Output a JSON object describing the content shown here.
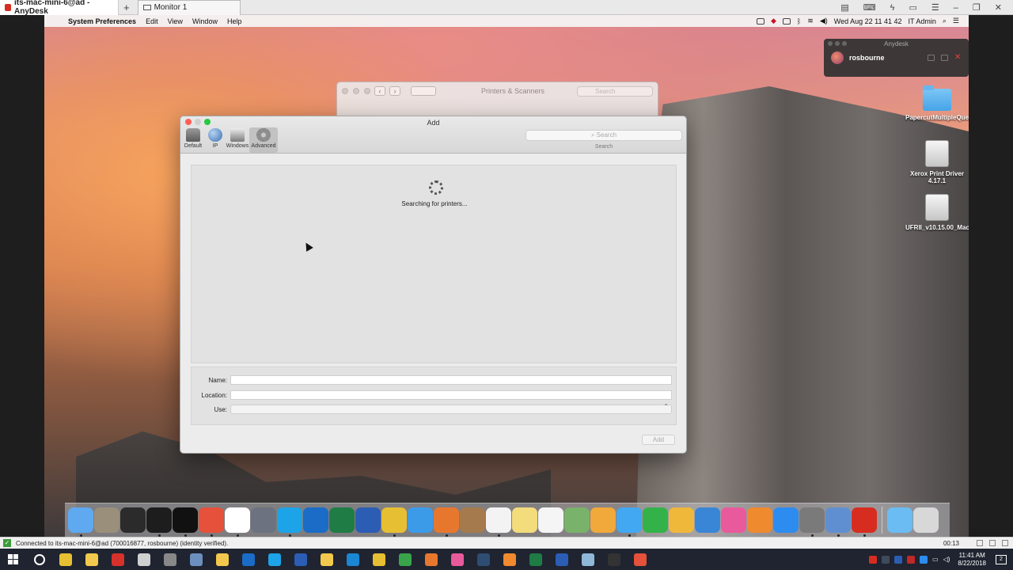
{
  "anydesk": {
    "tab_title": "its-mac-mini-6@ad - AnyDesk",
    "new_tab_label": "+",
    "monitor_tab": "Monitor 1",
    "status_text": "Connected to its-mac-mini-6@ad (700016877, rosbourne) (identity verified).",
    "session_timer": "00:13",
    "window_controls": {
      "minimize": "–",
      "restore": "❐",
      "close": "✕"
    }
  },
  "mac_menubar": {
    "app_name": "System Preferences",
    "menus": [
      "Edit",
      "View",
      "Window",
      "Help"
    ],
    "datetime": "Wed Aug 22  11 41 42",
    "user": "IT Admin"
  },
  "anydesk_panel": {
    "title": "Anydesk",
    "user": "rosbourne"
  },
  "desktop_icons": [
    {
      "label": "PapercutMultipleQueuesTest",
      "icon": "folder-icon"
    },
    {
      "label": "Xerox Print Driver 4.17.1",
      "icon": "disk-image-icon"
    },
    {
      "label": "UFRII_v10.15.00_Mac",
      "icon": "disk-image-icon"
    }
  ],
  "printers_window": {
    "title": "Printers & Scanners",
    "search_placeholder": "Search"
  },
  "add_window": {
    "title": "Add",
    "toolbar": [
      {
        "label": "Default",
        "icon": "printer-icon"
      },
      {
        "label": "IP",
        "icon": "globe-icon"
      },
      {
        "label": "Windows",
        "icon": "windows-printer-icon"
      },
      {
        "label": "Advanced",
        "icon": "gear-icon"
      }
    ],
    "selected_tab": "Advanced",
    "search_placeholder": "Search",
    "search_label": "Search",
    "status": "Searching for printers...",
    "fields": {
      "name_label": "Name:",
      "location_label": "Location:",
      "use_label": "Use:"
    },
    "add_button": "Add"
  },
  "dock": {
    "apps": [
      {
        "name": "Finder",
        "color": "#5ea9f0"
      },
      {
        "name": "Notes Pad",
        "color": "#9a8f7a"
      },
      {
        "name": "Disk Utility",
        "color": "#2b2b2b"
      },
      {
        "name": "Activity Monitor",
        "color": "#1d1d1d"
      },
      {
        "name": "Terminal",
        "color": "#111111"
      },
      {
        "name": "AnyDesk",
        "color": "#e5513b"
      },
      {
        "name": "FLIR Cloud",
        "color": "#ffffff"
      },
      {
        "name": "Launchpad",
        "color": "#6d7280"
      },
      {
        "name": "Skype",
        "color": "#1ca3e8"
      },
      {
        "name": "Outlook",
        "color": "#1a6cc7"
      },
      {
        "name": "Excel",
        "color": "#1f7c45"
      },
      {
        "name": "Word",
        "color": "#2c5db5"
      },
      {
        "name": "Chrome",
        "color": "#e6bf33"
      },
      {
        "name": "Safari",
        "color": "#3c9be8"
      },
      {
        "name": "Firefox",
        "color": "#e8772e"
      },
      {
        "name": "Contacts",
        "color": "#a57a4c"
      },
      {
        "name": "Calendar",
        "color": "#f3f3f3"
      },
      {
        "name": "Notes",
        "color": "#f2dc7c"
      },
      {
        "name": "Reminders",
        "color": "#f5f5f5"
      },
      {
        "name": "Maps",
        "color": "#79b26a"
      },
      {
        "name": "Photos",
        "color": "#f0a93a"
      },
      {
        "name": "Messages",
        "color": "#42a8f2"
      },
      {
        "name": "FaceTime",
        "color": "#34b24a"
      },
      {
        "name": "Pages",
        "color": "#f0b83a"
      },
      {
        "name": "Keynote",
        "color": "#3a86d6"
      },
      {
        "name": "iTunes",
        "color": "#e85a9b"
      },
      {
        "name": "iBooks",
        "color": "#f08a2e"
      },
      {
        "name": "App Store",
        "color": "#2c8cf0"
      },
      {
        "name": "System Preferences",
        "color": "#7a7a7a"
      },
      {
        "name": "Screen Sharing",
        "color": "#5f8fd0"
      },
      {
        "name": "Printer Queue",
        "color": "#d62d20"
      }
    ],
    "folder": {
      "name": "Downloads",
      "color": "#6bbcf3"
    },
    "trash": {
      "name": "Trash",
      "color": "#d8d8d8"
    }
  },
  "taskbar": {
    "apps": [
      {
        "name": "Chrome",
        "color": "#e6bf33"
      },
      {
        "name": "File Explorer",
        "color": "#f2c94c"
      },
      {
        "name": "Acrobat",
        "color": "#d6312b"
      },
      {
        "name": "App",
        "color": "#d0d0d0"
      },
      {
        "name": "Tools",
        "color": "#888888"
      },
      {
        "name": "Remote Desktop",
        "color": "#6b8fbf"
      },
      {
        "name": "Explorer",
        "color": "#f2c94c"
      },
      {
        "name": "Outlook",
        "color": "#1a6cc7"
      },
      {
        "name": "Skype",
        "color": "#1ca3e8"
      },
      {
        "name": "Remote",
        "color": "#2c5db5"
      },
      {
        "name": "Folder",
        "color": "#f2c94c"
      },
      {
        "name": "Edge",
        "color": "#1b86d4"
      },
      {
        "name": "Chrome 2",
        "color": "#e6bf33"
      },
      {
        "name": "Chrome 3",
        "color": "#3aa44a"
      },
      {
        "name": "Firefox",
        "color": "#e8772e"
      },
      {
        "name": "iTunes",
        "color": "#e85a9b"
      },
      {
        "name": "Amazon",
        "color": "#2e4d72"
      },
      {
        "name": "VLC",
        "color": "#f08a2e"
      },
      {
        "name": "Excel",
        "color": "#1f7c45"
      },
      {
        "name": "Word",
        "color": "#2c5db5"
      },
      {
        "name": "Files",
        "color": "#8fb8d8"
      },
      {
        "name": "OBS",
        "color": "#333333"
      },
      {
        "name": "AnyDesk",
        "color": "#e5513b"
      }
    ],
    "time": "11:41 AM",
    "date": "8/22/2018",
    "notifications": "2"
  }
}
